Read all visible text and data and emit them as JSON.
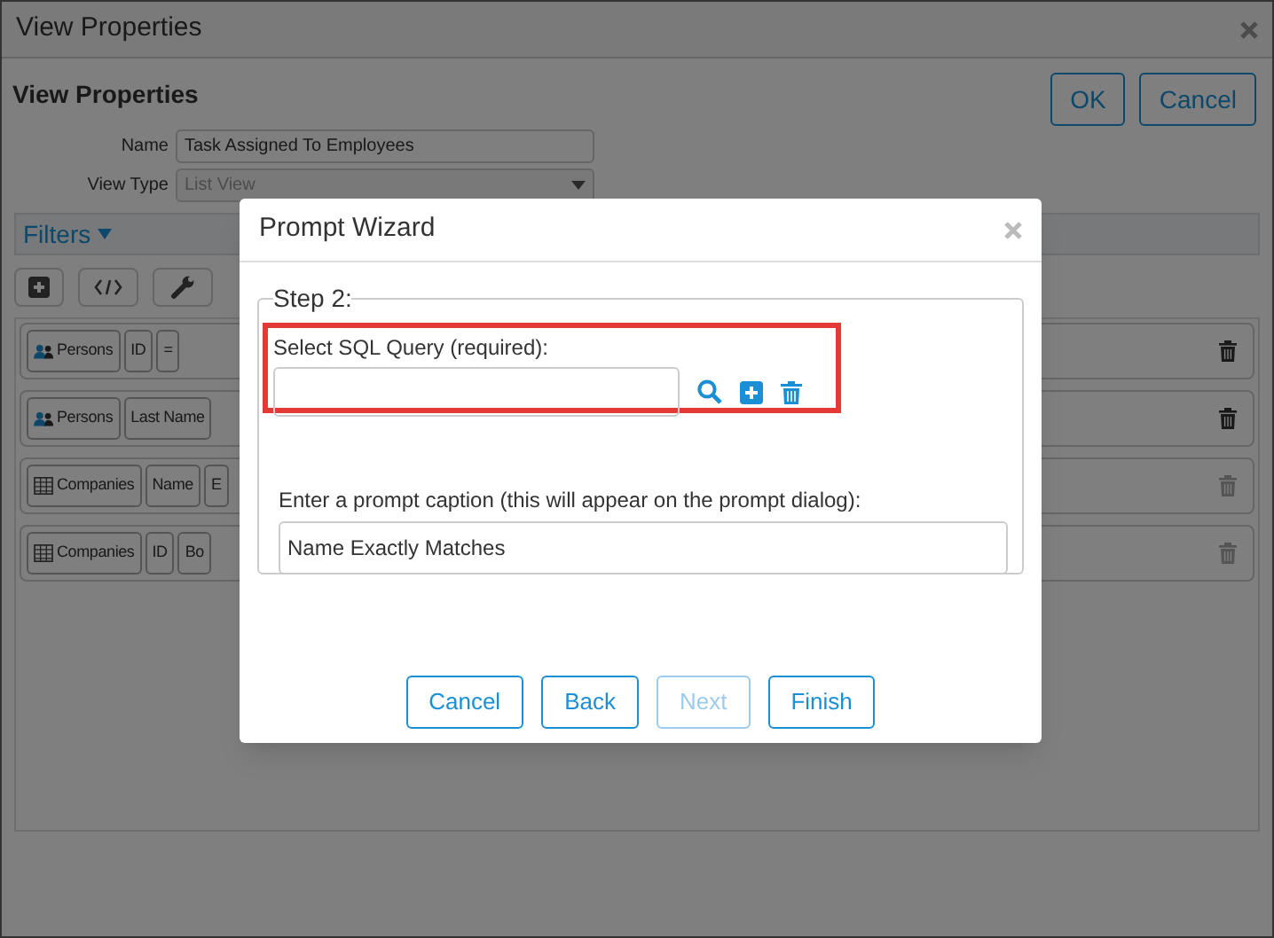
{
  "window": {
    "title": "View Properties"
  },
  "header": {
    "title": "View Properties",
    "buttons": [
      "OK",
      "Cancel"
    ]
  },
  "form": {
    "fields": [
      {
        "label": "Name",
        "value": "Task Assigned To Employees",
        "kind": "text"
      },
      {
        "label": "View Type",
        "value": "List View",
        "kind": "select"
      }
    ]
  },
  "filters": {
    "title": "Filters",
    "expanded": true,
    "rows": [
      {
        "chips": [
          {
            "text": "Persons",
            "kind": "persons"
          },
          {
            "text": "ID",
            "kind": "plain"
          },
          {
            "text": "=",
            "kind": "plain"
          }
        ],
        "disabled": false
      },
      {
        "chips": [
          {
            "text": "Persons",
            "kind": "persons"
          },
          {
            "text": "Last Name",
            "kind": "plain"
          }
        ],
        "disabled": false
      },
      {
        "chips": [
          {
            "text": "Companies",
            "kind": "companies"
          },
          {
            "text": "Name",
            "kind": "plain"
          },
          {
            "text": "E",
            "kind": "plain"
          }
        ],
        "disabled": true
      },
      {
        "chips": [
          {
            "text": "Companies",
            "kind": "companies"
          },
          {
            "text": "ID",
            "kind": "plain"
          },
          {
            "text": "Bo",
            "kind": "plain"
          }
        ],
        "disabled": true
      }
    ]
  },
  "dialog": {
    "title": "Prompt Wizard",
    "step": "Step 2:",
    "query": {
      "label": "Select SQL Query (required):",
      "highlighted": true
    },
    "caption": {
      "label": "Enter a prompt caption (this will appear on the prompt dialog):",
      "value": "Name Exactly Matches"
    },
    "buttons": [
      {
        "label": "Cancel",
        "disabled": false
      },
      {
        "label": "Back",
        "disabled": false
      },
      {
        "label": "Next",
        "disabled": true
      },
      {
        "label": "Finish",
        "disabled": false
      }
    ]
  }
}
